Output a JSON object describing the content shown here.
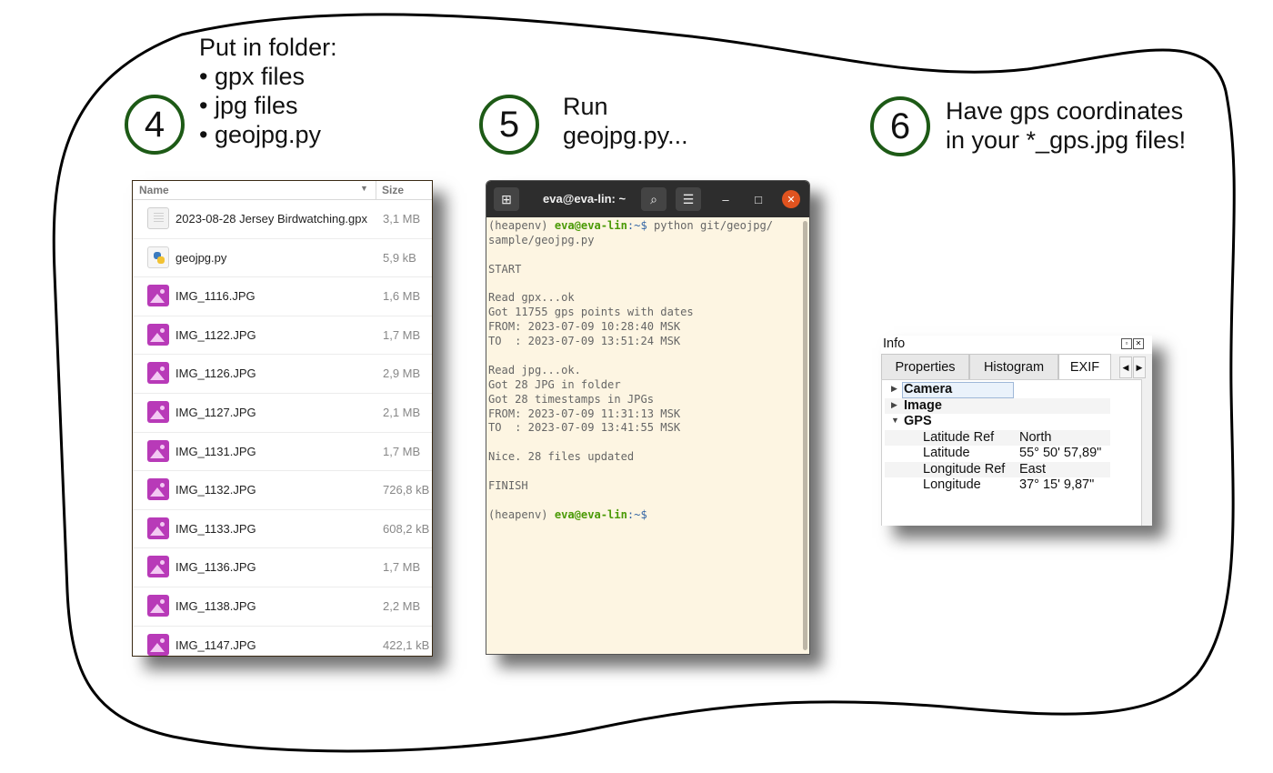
{
  "steps": [
    {
      "number": "4",
      "lines": [
        "Put in folder:",
        "• gpx files",
        "• jpg files",
        "• geojpg.py"
      ]
    },
    {
      "number": "5",
      "lines": [
        "Run",
        "geojpg.py..."
      ]
    },
    {
      "number": "6",
      "lines": [
        "Have gps coordinates",
        "in your *_gps.jpg files!"
      ]
    }
  ],
  "file_manager": {
    "columns": {
      "name": "Name",
      "size": "Size"
    },
    "files": [
      {
        "name": "2023-08-28 Jersey Birdwatching.gpx",
        "size": "3,1 MB",
        "icon": "document-icon"
      },
      {
        "name": "geojpg.py",
        "size": "5,9 kB",
        "icon": "python-file-icon"
      },
      {
        "name": "IMG_1116.JPG",
        "size": "1,6 MB",
        "icon": "image-file-icon"
      },
      {
        "name": "IMG_1122.JPG",
        "size": "1,7 MB",
        "icon": "image-file-icon"
      },
      {
        "name": "IMG_1126.JPG",
        "size": "2,9 MB",
        "icon": "image-file-icon"
      },
      {
        "name": "IMG_1127.JPG",
        "size": "2,1 MB",
        "icon": "image-file-icon"
      },
      {
        "name": "IMG_1131.JPG",
        "size": "1,7 MB",
        "icon": "image-file-icon"
      },
      {
        "name": "IMG_1132.JPG",
        "size": "726,8 kB",
        "icon": "image-file-icon"
      },
      {
        "name": "IMG_1133.JPG",
        "size": "608,2 kB",
        "icon": "image-file-icon"
      },
      {
        "name": "IMG_1136.JPG",
        "size": "1,7 MB",
        "icon": "image-file-icon"
      },
      {
        "name": "IMG_1138.JPG",
        "size": "2,2 MB",
        "icon": "image-file-icon"
      },
      {
        "name": "IMG_1147.JPG",
        "size": "422,1 kB",
        "icon": "image-file-icon"
      }
    ]
  },
  "terminal": {
    "title": "eva@eva-lin: ~",
    "prompt_env": "(heapenv) ",
    "prompt_user": "eva@eva-lin",
    "prompt_path": ":~$",
    "command": " python git/geojpg/",
    "command_cont": "sample/geojpg.py",
    "output": [
      "",
      "START",
      "",
      "Read gpx...ok",
      "Got 11755 gps points with dates",
      "FROM: 2023-07-09 10:28:40 MSK",
      "TO  : 2023-07-09 13:51:24 MSK",
      "",
      "Read jpg...ok.",
      "Got 28 JPG in folder",
      "Got 28 timestamps in JPGs",
      "FROM: 2023-07-09 11:31:13 MSK",
      "TO  : 2023-07-09 13:41:55 MSK",
      "",
      "Nice. 28 files updated",
      "",
      "FINISH",
      ""
    ]
  },
  "info_panel": {
    "title": "Info",
    "tabs": [
      "Properties",
      "Histogram",
      "EXIF"
    ],
    "active_tab": "EXIF",
    "groups": [
      "Camera",
      "Image",
      "GPS"
    ],
    "gps_fields": [
      {
        "key": "Latitude Ref",
        "value": "North"
      },
      {
        "key": "Latitude",
        "value": "55° 50' 57,89\""
      },
      {
        "key": "Longitude Ref",
        "value": "East"
      },
      {
        "key": "Longitude",
        "value": "37° 15' 9,87\""
      }
    ]
  },
  "colors": {
    "circle_border": "#1d5a16",
    "terminal_bg": "#fdf5e2",
    "terminal_user": "#4a9a06",
    "terminal_path": "#3465a4",
    "image_icon": "#b83ab8",
    "close_button": "#e0531f"
  }
}
